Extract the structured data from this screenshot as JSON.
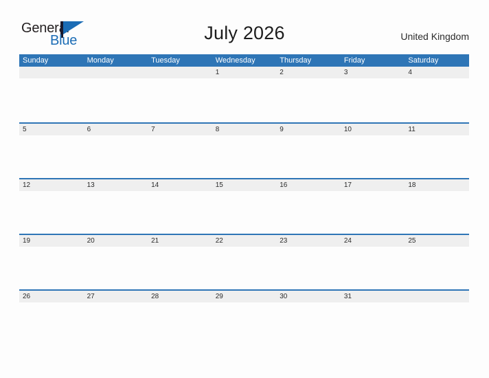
{
  "brand": {
    "name_part1": "General",
    "name_part2": "Blue",
    "flag_icon": "flag-icon"
  },
  "header": {
    "title": "July 2026",
    "locale": "United Kingdom"
  },
  "theme": {
    "header_blue": "#2e75b6",
    "band_gray": "#efefef",
    "page_bg": "#fdfdfd",
    "logo_blue": "#1b6cb5",
    "text_dark": "#2b2b2b"
  },
  "calendar": {
    "month": "July",
    "year": "2026",
    "weekday_headers": [
      "Sunday",
      "Monday",
      "Tuesday",
      "Wednesday",
      "Thursday",
      "Friday",
      "Saturday"
    ],
    "weeks": [
      {
        "days": [
          {
            "date": ""
          },
          {
            "date": ""
          },
          {
            "date": ""
          },
          {
            "date": "1"
          },
          {
            "date": "2"
          },
          {
            "date": "3"
          },
          {
            "date": "4"
          }
        ]
      },
      {
        "days": [
          {
            "date": "5"
          },
          {
            "date": "6"
          },
          {
            "date": "7"
          },
          {
            "date": "8"
          },
          {
            "date": "9"
          },
          {
            "date": "10"
          },
          {
            "date": "11"
          }
        ]
      },
      {
        "days": [
          {
            "date": "12"
          },
          {
            "date": "13"
          },
          {
            "date": "14"
          },
          {
            "date": "15"
          },
          {
            "date": "16"
          },
          {
            "date": "17"
          },
          {
            "date": "18"
          }
        ]
      },
      {
        "days": [
          {
            "date": "19"
          },
          {
            "date": "20"
          },
          {
            "date": "21"
          },
          {
            "date": "22"
          },
          {
            "date": "23"
          },
          {
            "date": "24"
          },
          {
            "date": "25"
          }
        ]
      },
      {
        "days": [
          {
            "date": "26"
          },
          {
            "date": "27"
          },
          {
            "date": "28"
          },
          {
            "date": "29"
          },
          {
            "date": "30"
          },
          {
            "date": "31"
          },
          {
            "date": ""
          }
        ]
      }
    ]
  }
}
